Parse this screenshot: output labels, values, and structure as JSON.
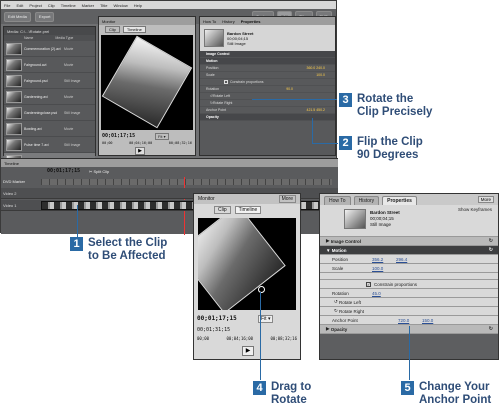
{
  "app": {
    "menu": [
      "File",
      "Edit",
      "Project",
      "Clip",
      "Timeline",
      "Marker",
      "Title",
      "Window",
      "Help"
    ],
    "toolbar": {
      "edit_media": "Edit Media",
      "export": "Export",
      "capture": "Capture",
      "edit": "Edit",
      "titles": "Titles",
      "dvd": "DVD"
    },
    "media_panel": {
      "title": "Media: C:\\...\\Rotate.prel",
      "columns": [
        "Name",
        "Media Type"
      ],
      "items": [
        {
          "name": "Commemoration (2).avi",
          "type": "Movie"
        },
        {
          "name": "Fairground.avi",
          "type": "Movie"
        },
        {
          "name": "Fairground.psd",
          "type": "Still Image"
        },
        {
          "name": "Gardenning.avi",
          "type": "Movie"
        },
        {
          "name": "Gardenningclose.psd",
          "type": "Still Image"
        },
        {
          "name": "Bowling.avi",
          "type": "Movie"
        },
        {
          "name": "Pulse time 7.avi",
          "type": "Still Image"
        },
        {
          "name": "Bardon Street",
          "type": "Still Image"
        }
      ]
    },
    "monitor": {
      "title": "Monitor",
      "tab_clip": "Clip",
      "tab_timeline": "Timeline",
      "timecode": "00;01;17;15",
      "fit": "Fit",
      "ruler": [
        "00;00",
        "00;04;16;00",
        "00;08;32;16"
      ]
    },
    "properties": {
      "tabs": [
        "How To",
        "History",
        "Properties"
      ],
      "clip_name": "Bardon Street",
      "clip_duration": "00;00;04;15",
      "clip_type": "Still Image",
      "rows": [
        {
          "label": "Image Control",
          "value": ""
        },
        {
          "label": "Motion",
          "value": ""
        },
        {
          "label": "Position",
          "value": "360.0  240.0"
        },
        {
          "label": "Scale",
          "value": "100.0"
        },
        {
          "label": "Constrain proportions",
          "value": ""
        },
        {
          "label": "Rotation",
          "value": "90.0"
        },
        {
          "label": "Rotate Left",
          "value": ""
        },
        {
          "label": "Rotate Right",
          "value": ""
        },
        {
          "label": "Anchor Point",
          "value": "421.5  450.2"
        },
        {
          "label": "Opacity",
          "value": ""
        }
      ]
    },
    "timeline": {
      "title": "Timeline",
      "timecode": "00;01;17;15",
      "split_clip": "Split Clip",
      "dvd_marker": "DVD Marker",
      "tracks": [
        "Video 2",
        "Video 1"
      ]
    }
  },
  "zoom_monitor": {
    "title": "Monitor",
    "menu": "More",
    "tab_clip": "Clip",
    "tab_timeline": "Timeline",
    "timecode": "00;01;17;15",
    "fit": "Fit",
    "end_timecode": "00;01;31;15",
    "ruler": [
      "00;00",
      "00;04;16;00",
      "00;08;32;16"
    ]
  },
  "zoom_properties": {
    "tabs": [
      "How To",
      "History",
      "Properties"
    ],
    "more": "More",
    "show_keyframes": "Show Keyframes",
    "clip_name": "Bardon Street",
    "clip_duration": "00;00;04;15",
    "clip_type": "Still Image",
    "image_control": "Image Control",
    "motion": "Motion",
    "position_label": "Position",
    "position_x": "356.2",
    "position_y": "296.4",
    "scale_label": "Scale",
    "scale_value": "100.0",
    "constrain": "Constrain proportions",
    "rotation_label": "Rotation",
    "rotation_value": "45.0",
    "rotate_left": "Rotate Left",
    "rotate_right": "Rotate Right",
    "anchor_label": "Anchor Point",
    "anchor_x": "720.0",
    "anchor_y": "150.0",
    "opacity": "Opacity"
  },
  "callouts": {
    "c1": {
      "num": "1",
      "line1": "Select the Clip",
      "line2": "to Be Affected"
    },
    "c2": {
      "num": "2",
      "line1": "Flip the Clip",
      "line2": "90 Degrees"
    },
    "c3": {
      "num": "3",
      "line1": "Rotate the",
      "line2": "Clip Precisely"
    },
    "c4": {
      "num": "4",
      "line1": "Drag to",
      "line2": "Rotate"
    },
    "c5": {
      "num": "5",
      "line1": "Change Your",
      "line2": "Anchor Point"
    }
  },
  "colors": {
    "callout_blue": "#2a6aa5",
    "callout_text": "#2f4d77",
    "value_gold": "#ffcf4a",
    "value_link": "#2a4f96"
  }
}
